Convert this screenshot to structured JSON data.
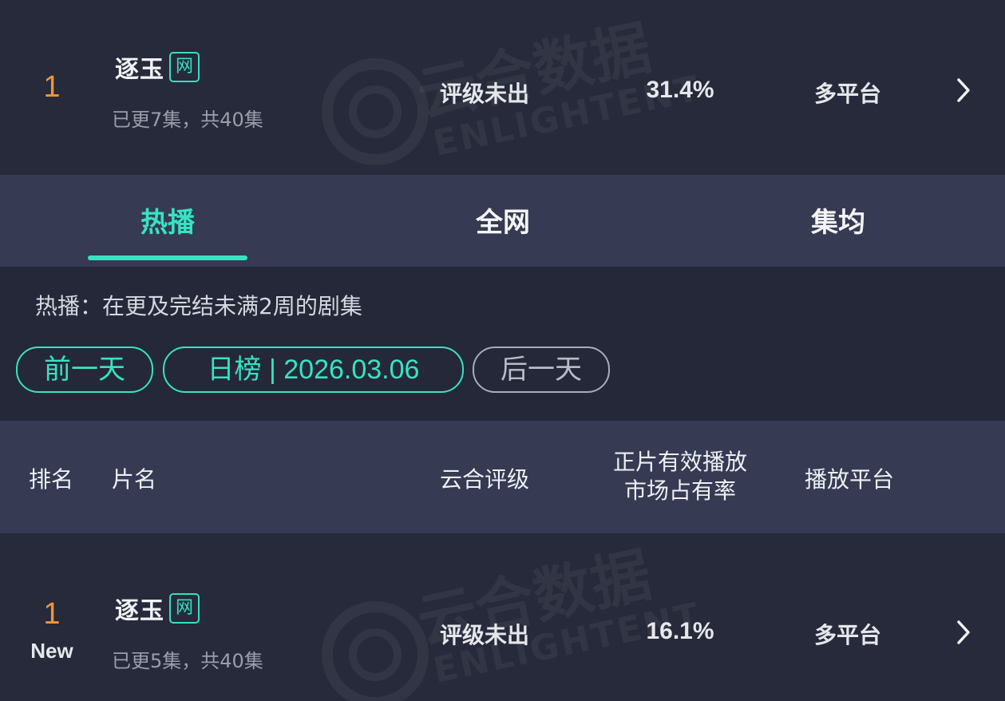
{
  "top_item": {
    "rank": "1",
    "title": "逐玉",
    "badge": "网",
    "episodes": "已更7集，共40集",
    "rating": "评级未出",
    "share": "31.4%",
    "platform": "多平台"
  },
  "tabs": [
    {
      "label": "热播",
      "active": true
    },
    {
      "label": "全网",
      "active": false
    },
    {
      "label": "集均",
      "active": false
    }
  ],
  "filter": {
    "description": "热播：在更及完结未满2周的剧集",
    "prev_day": "前一天",
    "date_label": "日榜 | 2026.03.06",
    "next_day": "后一天"
  },
  "table_header": {
    "rank": "排名",
    "title": "片名",
    "rating": "云合评级",
    "share_line1": "正片有效播放",
    "share_line2": "市场占有率",
    "platform": "播放平台"
  },
  "rows": [
    {
      "rank": "1",
      "new_label": "New",
      "title": "逐玉",
      "badge": "网",
      "episodes": "已更5集，共40集",
      "rating": "评级未出",
      "share": "16.1%",
      "platform": "多平台"
    }
  ],
  "watermark": {
    "cn": "云合数据",
    "en": "ENLIGHTENT"
  },
  "colors": {
    "accent": "#35e4c4",
    "rank": "#f0953a",
    "background": "#252838",
    "header_bg": "#363a52"
  }
}
